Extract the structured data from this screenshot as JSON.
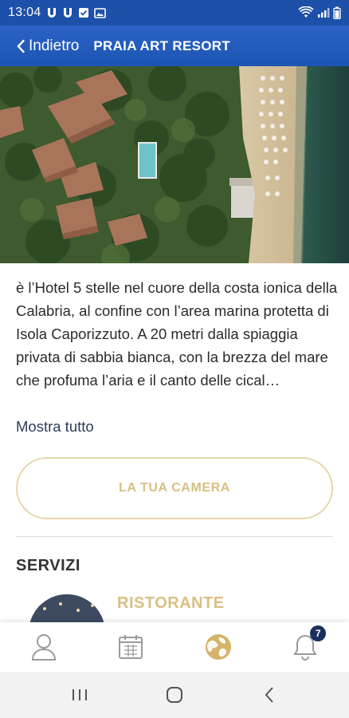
{
  "status_bar": {
    "time": "13:04",
    "left_icons": [
      "u-app-icon",
      "u-app-icon",
      "check-message-icon",
      "image-icon"
    ],
    "right_icons": [
      "wifi-icon",
      "signal-icon",
      "battery-icon"
    ],
    "background": "#1d50a8"
  },
  "header": {
    "back_label": "Indietro",
    "title": "PRAIA ART RESORT"
  },
  "description": {
    "text": "è l’Hotel 5 stelle nel cuore della costa ionica della Calabria, al confine con l’area marina protetta di Isola Caporizzuto. A 20 metri dalla spiaggia privata di sabbia bianca, con la brezza del mare che profuma l’aria e il canto delle cical…",
    "show_more": "Mostra tutto"
  },
  "room_button": {
    "label": "LA TUA CAMERA"
  },
  "services": {
    "title": "SERVIZI",
    "items": [
      {
        "name": "RISTORANTE"
      }
    ]
  },
  "bottom_nav": {
    "items": [
      {
        "icon": "user-icon"
      },
      {
        "icon": "calendar-icon"
      },
      {
        "icon": "globe-icon",
        "active": true
      },
      {
        "icon": "bell-icon",
        "badge": "7"
      }
    ]
  },
  "android_nav": [
    "recent-apps-icon",
    "home-icon",
    "back-icon"
  ],
  "colors": {
    "accent_gold": "#d7bf83",
    "header_blue": "#1d55b4",
    "badge_navy": "#1c2f5e"
  }
}
